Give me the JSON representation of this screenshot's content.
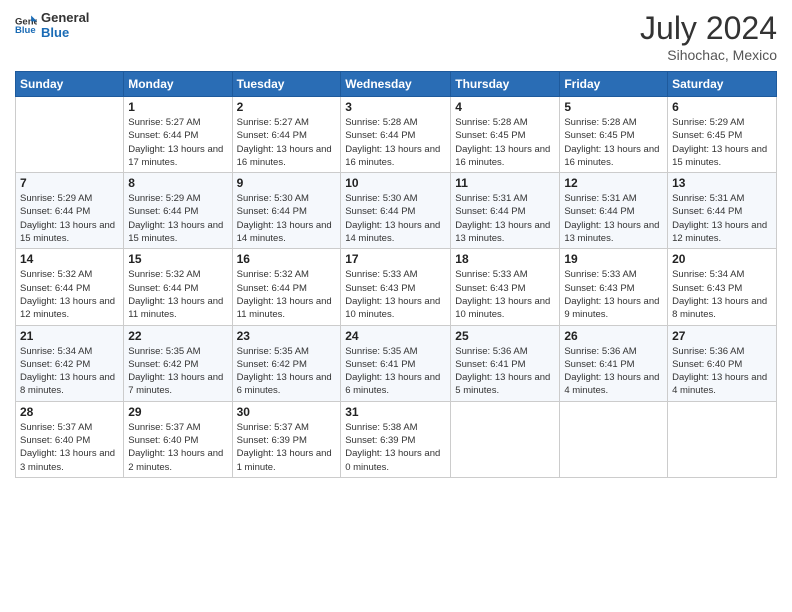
{
  "header": {
    "logo_line1": "General",
    "logo_line2": "Blue",
    "month": "July 2024",
    "location": "Sihochac, Mexico"
  },
  "weekdays": [
    "Sunday",
    "Monday",
    "Tuesday",
    "Wednesday",
    "Thursday",
    "Friday",
    "Saturday"
  ],
  "weeks": [
    [
      {
        "day": "",
        "sunrise": "",
        "sunset": "",
        "daylight": ""
      },
      {
        "day": "1",
        "sunrise": "Sunrise: 5:27 AM",
        "sunset": "Sunset: 6:44 PM",
        "daylight": "Daylight: 13 hours and 17 minutes."
      },
      {
        "day": "2",
        "sunrise": "Sunrise: 5:27 AM",
        "sunset": "Sunset: 6:44 PM",
        "daylight": "Daylight: 13 hours and 16 minutes."
      },
      {
        "day": "3",
        "sunrise": "Sunrise: 5:28 AM",
        "sunset": "Sunset: 6:44 PM",
        "daylight": "Daylight: 13 hours and 16 minutes."
      },
      {
        "day": "4",
        "sunrise": "Sunrise: 5:28 AM",
        "sunset": "Sunset: 6:45 PM",
        "daylight": "Daylight: 13 hours and 16 minutes."
      },
      {
        "day": "5",
        "sunrise": "Sunrise: 5:28 AM",
        "sunset": "Sunset: 6:45 PM",
        "daylight": "Daylight: 13 hours and 16 minutes."
      },
      {
        "day": "6",
        "sunrise": "Sunrise: 5:29 AM",
        "sunset": "Sunset: 6:45 PM",
        "daylight": "Daylight: 13 hours and 15 minutes."
      }
    ],
    [
      {
        "day": "7",
        "sunrise": "Sunrise: 5:29 AM",
        "sunset": "Sunset: 6:44 PM",
        "daylight": "Daylight: 13 hours and 15 minutes."
      },
      {
        "day": "8",
        "sunrise": "Sunrise: 5:29 AM",
        "sunset": "Sunset: 6:44 PM",
        "daylight": "Daylight: 13 hours and 15 minutes."
      },
      {
        "day": "9",
        "sunrise": "Sunrise: 5:30 AM",
        "sunset": "Sunset: 6:44 PM",
        "daylight": "Daylight: 13 hours and 14 minutes."
      },
      {
        "day": "10",
        "sunrise": "Sunrise: 5:30 AM",
        "sunset": "Sunset: 6:44 PM",
        "daylight": "Daylight: 13 hours and 14 minutes."
      },
      {
        "day": "11",
        "sunrise": "Sunrise: 5:31 AM",
        "sunset": "Sunset: 6:44 PM",
        "daylight": "Daylight: 13 hours and 13 minutes."
      },
      {
        "day": "12",
        "sunrise": "Sunrise: 5:31 AM",
        "sunset": "Sunset: 6:44 PM",
        "daylight": "Daylight: 13 hours and 13 minutes."
      },
      {
        "day": "13",
        "sunrise": "Sunrise: 5:31 AM",
        "sunset": "Sunset: 6:44 PM",
        "daylight": "Daylight: 13 hours and 12 minutes."
      }
    ],
    [
      {
        "day": "14",
        "sunrise": "Sunrise: 5:32 AM",
        "sunset": "Sunset: 6:44 PM",
        "daylight": "Daylight: 13 hours and 12 minutes."
      },
      {
        "day": "15",
        "sunrise": "Sunrise: 5:32 AM",
        "sunset": "Sunset: 6:44 PM",
        "daylight": "Daylight: 13 hours and 11 minutes."
      },
      {
        "day": "16",
        "sunrise": "Sunrise: 5:32 AM",
        "sunset": "Sunset: 6:44 PM",
        "daylight": "Daylight: 13 hours and 11 minutes."
      },
      {
        "day": "17",
        "sunrise": "Sunrise: 5:33 AM",
        "sunset": "Sunset: 6:43 PM",
        "daylight": "Daylight: 13 hours and 10 minutes."
      },
      {
        "day": "18",
        "sunrise": "Sunrise: 5:33 AM",
        "sunset": "Sunset: 6:43 PM",
        "daylight": "Daylight: 13 hours and 10 minutes."
      },
      {
        "day": "19",
        "sunrise": "Sunrise: 5:33 AM",
        "sunset": "Sunset: 6:43 PM",
        "daylight": "Daylight: 13 hours and 9 minutes."
      },
      {
        "day": "20",
        "sunrise": "Sunrise: 5:34 AM",
        "sunset": "Sunset: 6:43 PM",
        "daylight": "Daylight: 13 hours and 8 minutes."
      }
    ],
    [
      {
        "day": "21",
        "sunrise": "Sunrise: 5:34 AM",
        "sunset": "Sunset: 6:42 PM",
        "daylight": "Daylight: 13 hours and 8 minutes."
      },
      {
        "day": "22",
        "sunrise": "Sunrise: 5:35 AM",
        "sunset": "Sunset: 6:42 PM",
        "daylight": "Daylight: 13 hours and 7 minutes."
      },
      {
        "day": "23",
        "sunrise": "Sunrise: 5:35 AM",
        "sunset": "Sunset: 6:42 PM",
        "daylight": "Daylight: 13 hours and 6 minutes."
      },
      {
        "day": "24",
        "sunrise": "Sunrise: 5:35 AM",
        "sunset": "Sunset: 6:41 PM",
        "daylight": "Daylight: 13 hours and 6 minutes."
      },
      {
        "day": "25",
        "sunrise": "Sunrise: 5:36 AM",
        "sunset": "Sunset: 6:41 PM",
        "daylight": "Daylight: 13 hours and 5 minutes."
      },
      {
        "day": "26",
        "sunrise": "Sunrise: 5:36 AM",
        "sunset": "Sunset: 6:41 PM",
        "daylight": "Daylight: 13 hours and 4 minutes."
      },
      {
        "day": "27",
        "sunrise": "Sunrise: 5:36 AM",
        "sunset": "Sunset: 6:40 PM",
        "daylight": "Daylight: 13 hours and 4 minutes."
      }
    ],
    [
      {
        "day": "28",
        "sunrise": "Sunrise: 5:37 AM",
        "sunset": "Sunset: 6:40 PM",
        "daylight": "Daylight: 13 hours and 3 minutes."
      },
      {
        "day": "29",
        "sunrise": "Sunrise: 5:37 AM",
        "sunset": "Sunset: 6:40 PM",
        "daylight": "Daylight: 13 hours and 2 minutes."
      },
      {
        "day": "30",
        "sunrise": "Sunrise: 5:37 AM",
        "sunset": "Sunset: 6:39 PM",
        "daylight": "Daylight: 13 hours and 1 minute."
      },
      {
        "day": "31",
        "sunrise": "Sunrise: 5:38 AM",
        "sunset": "Sunset: 6:39 PM",
        "daylight": "Daylight: 13 hours and 0 minutes."
      },
      {
        "day": "",
        "sunrise": "",
        "sunset": "",
        "daylight": ""
      },
      {
        "day": "",
        "sunrise": "",
        "sunset": "",
        "daylight": ""
      },
      {
        "day": "",
        "sunrise": "",
        "sunset": "",
        "daylight": ""
      }
    ]
  ]
}
